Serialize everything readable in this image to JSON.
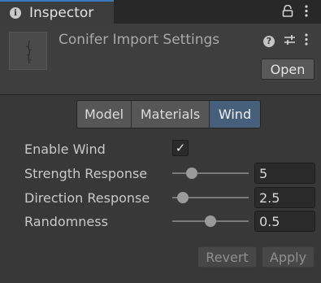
{
  "window": {
    "tab_title": "Inspector",
    "tab_icon": "info-icon",
    "tools": [
      "lock-icon",
      "kebab-menu-icon"
    ]
  },
  "header": {
    "title": "Conifer Import Settings",
    "open_label": "Open",
    "icons": [
      "help-icon",
      "preset-icon",
      "kebab-menu-icon"
    ]
  },
  "tabs": [
    {
      "label": "Model",
      "active": false
    },
    {
      "label": "Materials",
      "active": false
    },
    {
      "label": "Wind",
      "active": true
    }
  ],
  "fields": {
    "enable_wind": {
      "label": "Enable Wind",
      "checked": true,
      "check_glyph": "✓"
    },
    "strength": {
      "label": "Strength Response",
      "value": "5",
      "slider_fraction": 0.25
    },
    "direction": {
      "label": "Direction Response",
      "value": "2.5",
      "slider_fraction": 0.14
    },
    "randomness": {
      "label": "Randomness",
      "value": "0.5",
      "slider_fraction": 0.5
    }
  },
  "footer": {
    "revert_label": "Revert",
    "apply_label": "Apply"
  },
  "colors": {
    "accent": "#3a79bb",
    "active_tab": "#46607c",
    "background": "#383838"
  }
}
